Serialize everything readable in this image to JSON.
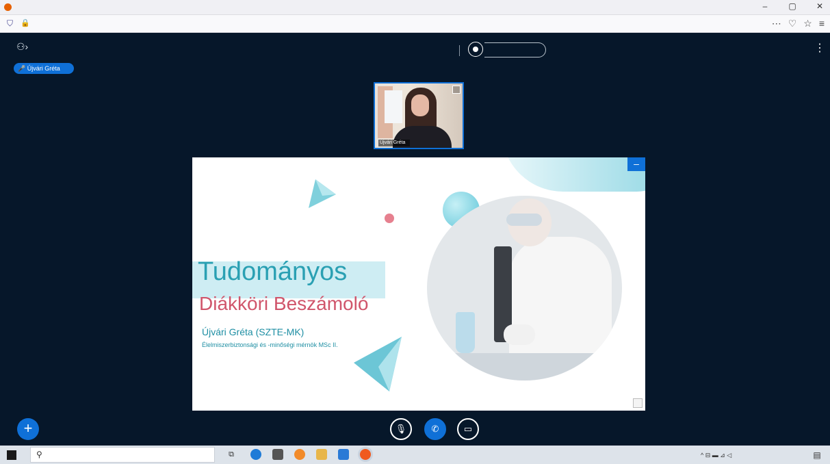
{
  "browser": {
    "tab_title": "",
    "url": "",
    "window_controls": [
      "–",
      "▢",
      "✕"
    ],
    "toolbar_icons": [
      "⋯",
      "♡",
      "☆",
      "≡"
    ]
  },
  "meeting": {
    "title": "",
    "record_label": "",
    "presenter_name": "Újvári Gréta",
    "webcam_name": "Újvári Gréta"
  },
  "slide": {
    "title": "Tudományos",
    "subtitle": "Diákköri Beszámoló",
    "author": "Újvári Gréta (SZTE-MK)",
    "program": "Élelmiszerbiztonsági és -minőségi mérnök MSc II."
  },
  "taskbar": {
    "search_placeholder": "",
    "tray_text": "^ ⊟ ▬ ⊿ ◁",
    "clock_time": "",
    "clock_date": ""
  },
  "colors": {
    "app_background": "#06172a",
    "accent_blue": "#0f70d7",
    "slide_title_teal": "#2aa0b3",
    "slide_subtitle_pink": "#d0556b"
  }
}
